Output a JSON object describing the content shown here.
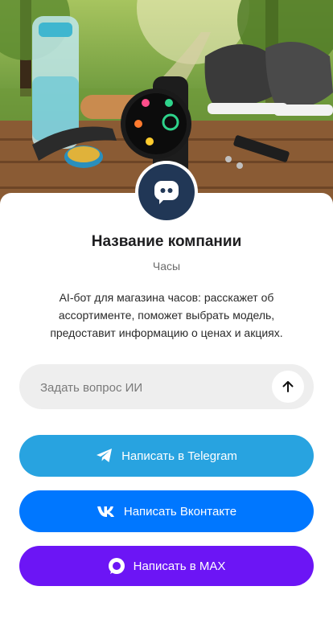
{
  "company": {
    "name": "Название компании",
    "category": "Часы",
    "description": "AI-бот для магазина часов: расскажет об ассортименте, поможет выбрать модель, предоставит информацию о ценах и акциях."
  },
  "ask": {
    "placeholder": "Задать вопрос ИИ",
    "value": ""
  },
  "buttons": {
    "telegram": "Написать в Telegram",
    "vk": "Написать Вконтакте",
    "max": "Написать в MAX"
  },
  "colors": {
    "avatar": "#213756",
    "telegram": "#28a3e0",
    "vk": "#0077ff",
    "max": "#6c15f5",
    "input_bg": "#eeeeee"
  },
  "icons": {
    "avatar": "chat-bubble-icon",
    "send": "arrow-up-icon",
    "telegram": "telegram-plane-icon",
    "vk": "vk-logo-icon",
    "max": "max-logo-icon"
  }
}
